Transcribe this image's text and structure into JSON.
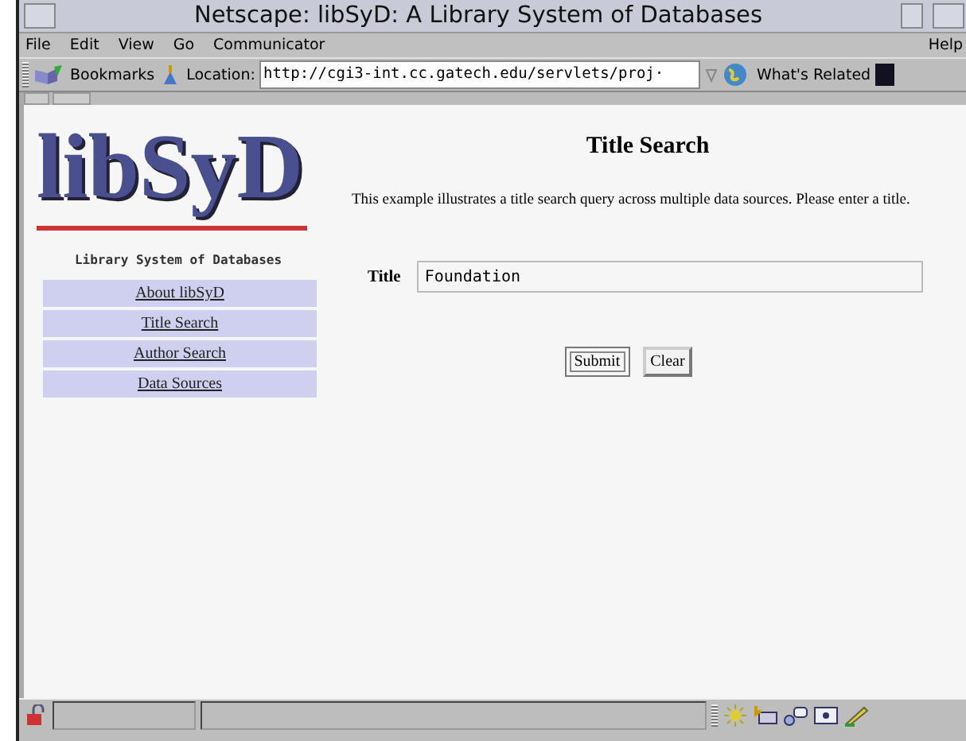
{
  "window": {
    "title": "Netscape: libSyD: A Library System of Databases"
  },
  "menu": {
    "items": [
      "File",
      "Edit",
      "View",
      "Go",
      "Communicator"
    ],
    "help": "Help"
  },
  "toolbar": {
    "bookmarks": "Bookmarks",
    "location_label": "Location:",
    "url": "http://cgi3-int.cc.gatech.edu/servlets/proj·",
    "related": "What's Related"
  },
  "sidebar": {
    "logo": "libSyD",
    "tagline": "Library System of Databases",
    "items": [
      {
        "label": "About libSyD"
      },
      {
        "label": "Title Search"
      },
      {
        "label": "Author Search"
      },
      {
        "label": "Data Sources"
      }
    ]
  },
  "main": {
    "heading": "Title Search",
    "description": "This example illustrates a title search query across multiple data sources. Please enter a title.",
    "field_label": "Title",
    "field_value": "Foundation",
    "buttons": [
      {
        "label": "Submit",
        "focused": true
      },
      {
        "label": "Clear",
        "focused": false
      }
    ]
  }
}
